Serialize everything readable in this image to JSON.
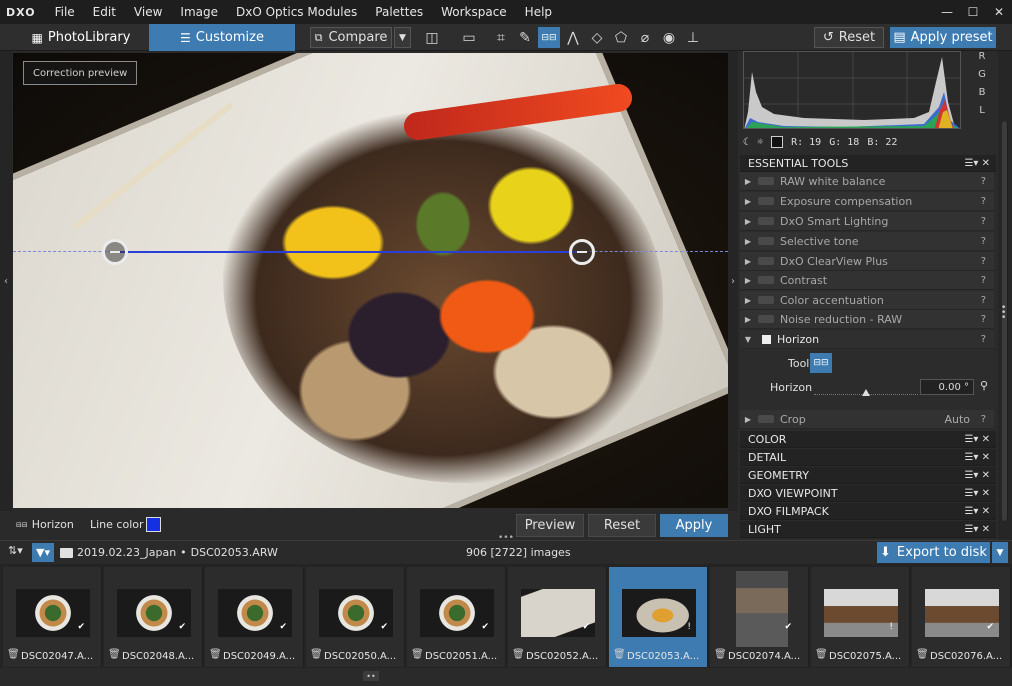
{
  "app": {
    "logo": "DXO"
  },
  "menu": [
    "File",
    "Edit",
    "View",
    "Image",
    "DxO Optics Modules",
    "Palettes",
    "Workspace",
    "Help"
  ],
  "window": {
    "minimize": "—",
    "maximize": "☐",
    "close": "✕"
  },
  "toolbar": {
    "tab_photolibrary": "PhotoLibrary",
    "tab_customize": "Customize",
    "compare_label": "Compare",
    "reset_label": "Reset",
    "apply_preset_label": "Apply preset"
  },
  "viewer": {
    "correction_preview": "Correction preview",
    "horizon_label": "Horizon",
    "line_color_label": "Line color",
    "line_color": "#1430e0",
    "preview_button": "Preview",
    "reset_button": "Reset",
    "apply_button": "Apply"
  },
  "histogram": {
    "channels": [
      "R",
      "G",
      "B",
      "L"
    ],
    "r_label": "R:",
    "r_value": "19",
    "g_label": "G:",
    "g_value": "18",
    "b_label": "B:",
    "b_value": "22"
  },
  "panel": {
    "essential_tools": "ESSENTIAL TOOLS",
    "tools": [
      {
        "label": "RAW white balance",
        "help": "?"
      },
      {
        "label": "Exposure compensation",
        "help": "?"
      },
      {
        "label": "DxO Smart Lighting",
        "help": "?"
      },
      {
        "label": "Selective tone",
        "help": "?"
      },
      {
        "label": "DxO ClearView Plus",
        "help": "?"
      },
      {
        "label": "Contrast",
        "help": "?"
      },
      {
        "label": "Color accentuation",
        "help": "?"
      },
      {
        "label": "Noise reduction - RAW",
        "help": "?"
      },
      {
        "label": "Horizon",
        "help": "?"
      }
    ],
    "horizon": {
      "tool_label": "Tool",
      "field_label": "Horizon",
      "value": "0.00 °",
      "slider_fraction": 0.5
    },
    "crop": {
      "label": "Crop",
      "extra": "Auto",
      "help": "?"
    },
    "sections": [
      "COLOR",
      "DETAIL",
      "GEOMETRY",
      "DXO VIEWPOINT",
      "DXO FILMPACK",
      "LIGHT"
    ]
  },
  "browser": {
    "folder": "2019.02.23_Japan",
    "separator": "•",
    "file": "DSC02053.ARW",
    "count": "906 [2722] images",
    "export_label": "Export to disk"
  },
  "filmstrip": [
    {
      "name": "DSC02047.A...",
      "kind": "bowl",
      "selected": false
    },
    {
      "name": "DSC02048.A...",
      "kind": "bowl",
      "selected": false
    },
    {
      "name": "DSC02049.A...",
      "kind": "bowl",
      "selected": false
    },
    {
      "name": "DSC02050.A...",
      "kind": "bowl",
      "selected": false
    },
    {
      "name": "DSC02051.A...",
      "kind": "bowl",
      "selected": false
    },
    {
      "name": "DSC02052.A...",
      "kind": "dish",
      "selected": false
    },
    {
      "name": "DSC02053.A...",
      "kind": "dish-sel",
      "selected": true
    },
    {
      "name": "DSC02074.A...",
      "kind": "temple",
      "selected": false
    },
    {
      "name": "DSC02075.A...",
      "kind": "house",
      "selected": false
    },
    {
      "name": "DSC02076.A...",
      "kind": "house",
      "selected": false
    }
  ]
}
